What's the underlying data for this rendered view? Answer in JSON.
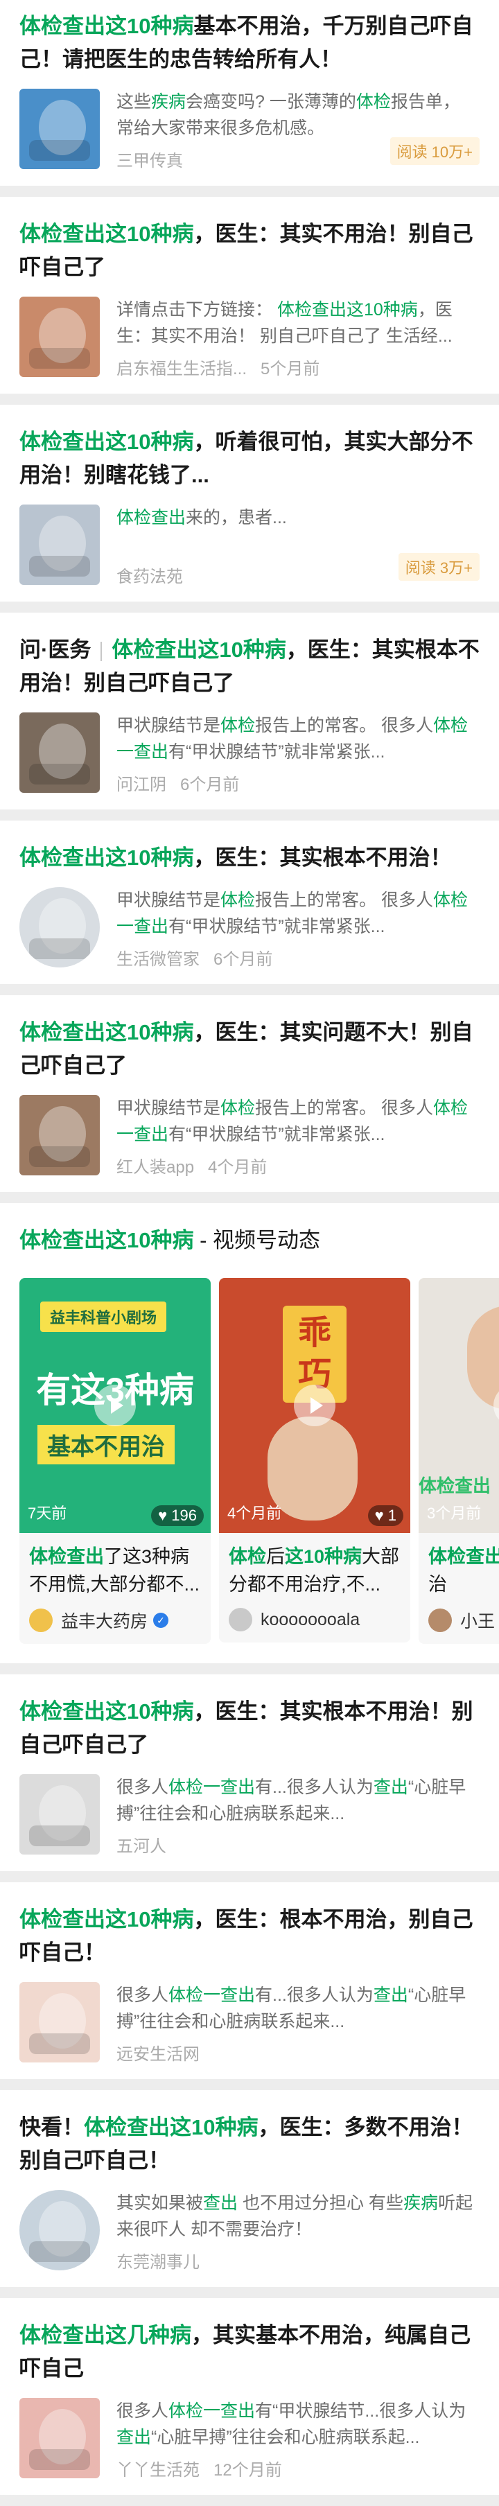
{
  "results": [
    {
      "title_parts": [
        [
          "体检查出这10种病",
          true
        ],
        [
          "基本不用治，千万别自己吓自己！请把医生的忠告转给所有人！",
          false
        ]
      ],
      "snippet_parts": [
        [
          "这些",
          false
        ],
        [
          "疾病",
          true
        ],
        [
          "会癌变吗? 一张薄薄的",
          false
        ],
        [
          "体检",
          true
        ],
        [
          "报告单， 常给大家带来很多危机感。",
          false
        ]
      ],
      "source": "三甲传真",
      "time": "",
      "badge": "阅读 10万+",
      "thumb_icon": "medical-image-icon",
      "thumb_color": "#4a8fc9"
    },
    {
      "title_parts": [
        [
          "体检查出这10种病",
          true
        ],
        [
          "，医生：其实不用治！别自己吓自己了",
          false
        ]
      ],
      "snippet_parts": [
        [
          "详情点击下方链接： ",
          false
        ],
        [
          "体检查出这10种病",
          true
        ],
        [
          "，医生：其实不用治！ 别自己吓自己了 生活经...",
          false
        ]
      ],
      "source": "启东福生生活指...",
      "time": "5个月前",
      "badge": "",
      "thumb_icon": "shoulder-pain-icon",
      "thumb_color": "#c98a6a"
    },
    {
      "title_parts": [
        [
          "体检查出这10种病",
          true
        ],
        [
          "，听着很可怕，其实大部分不用治！别瞎花钱了...",
          false
        ]
      ],
      "snippet_parts": [
        [
          "体检查出",
          true
        ],
        [
          "来的，患者...",
          false
        ]
      ],
      "source": "食药法苑",
      "time": "",
      "badge": "阅读 3万+",
      "thumb_icon": "blood-pressure-icon",
      "thumb_color": "#b9c4d0"
    },
    {
      "prefix": "问·医务",
      "title_parts": [
        [
          "体检查出这10种病",
          true
        ],
        [
          "，医生：其实根本不用治！别自己吓自己了",
          false
        ]
      ],
      "snippet_parts": [
        [
          "甲状腺结节是",
          false
        ],
        [
          "体检",
          true
        ],
        [
          "报告上的常客。 很多人",
          false
        ],
        [
          "体检一查出",
          true
        ],
        [
          "有“甲状腺结节”就非常紧张...",
          false
        ]
      ],
      "source": "问江阴",
      "time": "6个月前",
      "badge": "",
      "thumb_icon": "neck-icon",
      "thumb_color": "#7a6a5c"
    },
    {
      "title_parts": [
        [
          "体检查出这10种病",
          true
        ],
        [
          "，医生：其实根本不用治！",
          false
        ]
      ],
      "snippet_parts": [
        [
          "甲状腺结节是",
          false
        ],
        [
          "体检",
          true
        ],
        [
          "报告上的常客。 很多人",
          false
        ],
        [
          "体检一查出",
          true
        ],
        [
          "有“甲状腺结节”就非常紧张...",
          false
        ]
      ],
      "source": "生活微管家",
      "time": "6个月前",
      "badge": "",
      "round": true,
      "thumb_icon": "doctor-icon",
      "thumb_color": "#d8dde2"
    },
    {
      "title_parts": [
        [
          "体检查出这10种病",
          true
        ],
        [
          "，医生：其实问题不大！别自己吓自己了",
          false
        ]
      ],
      "snippet_parts": [
        [
          "甲状腺结节是",
          false
        ],
        [
          "体检",
          true
        ],
        [
          "报告上的常客。 很多人",
          false
        ],
        [
          "体检一查出",
          true
        ],
        [
          "有“甲状腺结节”就非常紧张...",
          false
        ]
      ],
      "source": "红人装app",
      "time": "4个月前",
      "badge": "",
      "thumb_icon": "stomach-ache-icon",
      "thumb_color": "#9c7a62"
    }
  ],
  "video_section": {
    "title_hl": "体检查出这10种病",
    "title_rest": " - 视频号动态",
    "videos": [
      {
        "banner": "益丰科普小剧场",
        "big1": "有这3种病",
        "big2": "基本不用治",
        "time": "7天前",
        "likes": "196",
        "text_parts": [
          [
            "体检查出",
            true
          ],
          [
            "了这3种病不用慌,大部分都不...",
            false
          ]
        ],
        "author": "益丰大药房",
        "verified": true,
        "bg": "#23b27a"
      },
      {
        "overlay": "乖巧",
        "time": "4个月前",
        "likes": "1",
        "text_parts": [
          [
            "体检",
            true
          ],
          [
            "后",
            false
          ],
          [
            "这10种病",
            true
          ],
          [
            "大部分都不用治疗,不...",
            false
          ]
        ],
        "author": "koooooooala",
        "verified": false,
        "bg": "#c94b2d"
      },
      {
        "overlay": "体检查出",
        "time": "3个月前",
        "likes": "",
        "text_parts": [
          [
            "体检查出",
            true
          ],
          [
            "这...本不用治",
            false
          ]
        ],
        "author": "小王",
        "verified": false,
        "bg": "#e8e4de"
      }
    ]
  },
  "results2": [
    {
      "title_parts": [
        [
          "体检查出这10种病",
          true
        ],
        [
          "，医生：其实根本不用治！别自己吓自己了",
          false
        ]
      ],
      "snippet_parts": [
        [
          "很多人",
          false
        ],
        [
          "体检一查出",
          true
        ],
        [
          "有...很多人认为",
          false
        ],
        [
          "查出",
          true
        ],
        [
          "“心脏早搏”往往会和心脏病联系起来...",
          false
        ]
      ],
      "source": "五河人",
      "time": "",
      "badge": "",
      "thumb_icon": "report-icon",
      "thumb_color": "#dcdcdc"
    },
    {
      "title_parts": [
        [
          "体检查出这10种病",
          true
        ],
        [
          "，医生：根本不用治，别自己吓自己！",
          false
        ]
      ],
      "snippet_parts": [
        [
          "很多人",
          false
        ],
        [
          "体检一查出",
          true
        ],
        [
          "有...很多人认为",
          false
        ],
        [
          "查出",
          true
        ],
        [
          "“心脏早搏”往往会和心脏病联系起来...",
          false
        ]
      ],
      "source": "远安生活网",
      "time": "",
      "badge": "",
      "thumb_icon": "heart-icon",
      "thumb_color": "#f1d9cf"
    },
    {
      "prefix_plain": "快看！",
      "title_parts": [
        [
          "体检查出这10种病",
          true
        ],
        [
          "，医生：多数不用治！别自己吓自己！",
          false
        ]
      ],
      "snippet_parts": [
        [
          "其实如果被",
          false
        ],
        [
          "查出",
          true
        ],
        [
          " 也不用过分担心 有些",
          false
        ],
        [
          "疾病",
          true
        ],
        [
          "听起来很吓人 却不需要治疗！",
          false
        ]
      ],
      "source": "东莞潮事儿",
      "time": "",
      "badge": "",
      "round": true,
      "thumb_icon": "scan-icon",
      "thumb_color": "#c7d3dd"
    },
    {
      "title_parts": [
        [
          "体检查出这几种病",
          true
        ],
        [
          "，其实基本不用治，纯属自己吓自己",
          false
        ]
      ],
      "snippet_parts": [
        [
          "很多人",
          false
        ],
        [
          "体检一查出",
          true
        ],
        [
          "有“甲状腺结节...很多人认为",
          false
        ],
        [
          "查出",
          true
        ],
        [
          "“心脏早搏”往往会和心脏病联系起...",
          false
        ]
      ],
      "source": "丫丫生活苑",
      "time": "12个月前",
      "badge": "",
      "thumb_icon": "uterus-icon",
      "thumb_color": "#e9b7b0"
    }
  ]
}
